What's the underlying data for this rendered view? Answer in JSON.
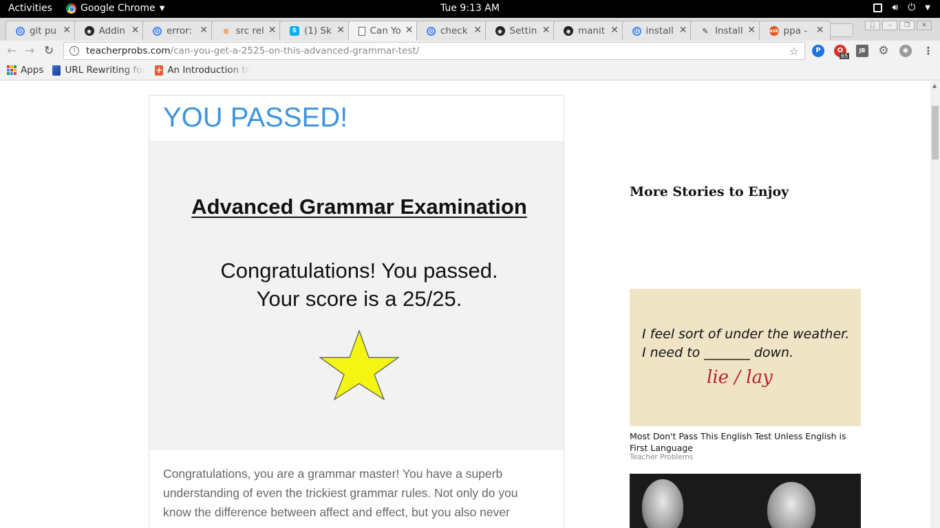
{
  "system_bar": {
    "activities": "Activities",
    "app_name": "Google Chrome",
    "clock": "Tue  9:13 AM"
  },
  "tabs": [
    {
      "icon": "google-icon",
      "label": "git pu"
    },
    {
      "icon": "github-icon",
      "label": "Addin"
    },
    {
      "icon": "google-icon",
      "label": "error:"
    },
    {
      "icon": "stackoverflow-icon",
      "label": "src rel"
    },
    {
      "icon": "skype-icon",
      "label": "(1) Sk"
    },
    {
      "icon": "document-icon",
      "label": "Can Yo",
      "active": true
    },
    {
      "icon": "google-icon",
      "label": "check"
    },
    {
      "icon": "github-icon",
      "label": "Settin"
    },
    {
      "icon": "github-icon",
      "label": "manit"
    },
    {
      "icon": "google-icon",
      "label": "install"
    },
    {
      "icon": "pen-icon",
      "label": "Install"
    },
    {
      "icon": "ask-icon",
      "label": "ppa -"
    }
  ],
  "address_bar": {
    "domain": "teacherprobs.com",
    "path": "/can-you-get-a-2525-on-this-advanced-grammar-test/"
  },
  "extensions": {
    "badge_count": "65"
  },
  "bookmarks": [
    {
      "icon": "apps-icon",
      "label": "Apps"
    },
    {
      "icon": "bookmark-favicon",
      "label": "URL Rewriting for"
    },
    {
      "icon": "bookmark-favicon",
      "label": "An Introduction to"
    }
  ],
  "quiz": {
    "result_title": "YOU PASSED!",
    "exam_title": "Advanced Grammar Examination",
    "message_line1": "Congratulations! You passed.",
    "message_line2": "Your score is a 25/25.",
    "star_color": "#f5f514",
    "description": "Congratulations, you are a grammar master! You have a superb understanding of even the trickiest grammar rules. Not only do you know the difference between affect and effect, but you also never"
  },
  "sidebar": {
    "heading": "More Stories to Enjoy",
    "story1": {
      "image_line1": "I feel sort of under the weather.",
      "image_line2": "I need to _______ down.",
      "image_answer": "lie / lay",
      "title": "Most Don't Pass This English Test Unless English is First Language",
      "source": "Teacher Problems"
    }
  },
  "colors": {
    "accent": "#3d94dc",
    "body_text": "#666666"
  }
}
